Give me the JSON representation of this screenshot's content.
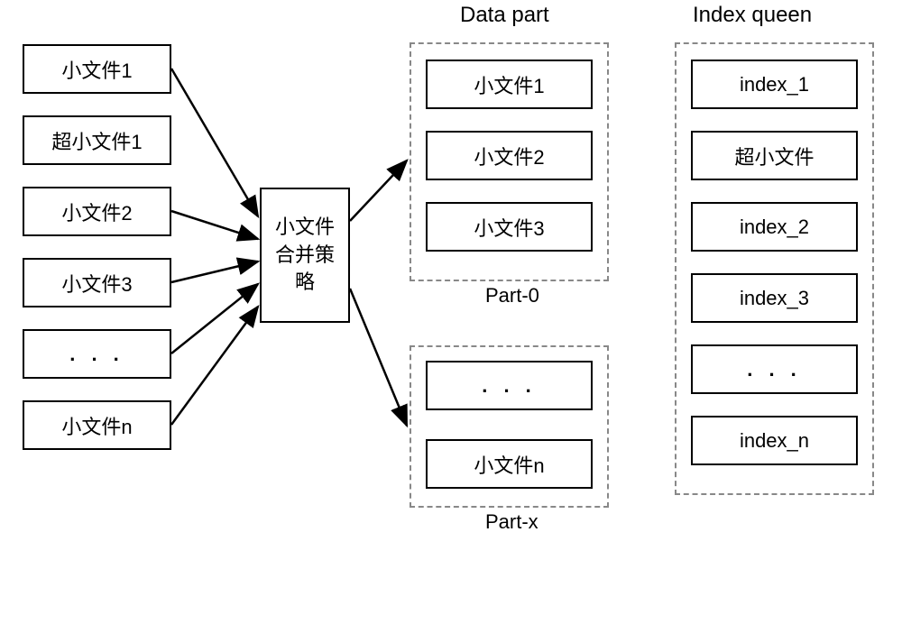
{
  "left_column": {
    "items": [
      "小文件1",
      "超小文件1",
      "小文件2",
      "小文件3",
      "小文件n"
    ],
    "ellipsis": ". . ."
  },
  "middle": {
    "label_line1": "小文件",
    "label_line2": "合并策略"
  },
  "data_part": {
    "title": "Data part",
    "part0": {
      "items": [
        "小文件1",
        "小文件2",
        "小文件3"
      ],
      "label": "Part-0"
    },
    "partx": {
      "items": [
        "小文件n"
      ],
      "ellipsis": ". . .",
      "label": "Part-x"
    }
  },
  "index_queen": {
    "title": "Index queen",
    "items": [
      "index_1",
      "超小文件",
      "index_2",
      "index_3",
      "index_n"
    ],
    "ellipsis": ". . ."
  }
}
